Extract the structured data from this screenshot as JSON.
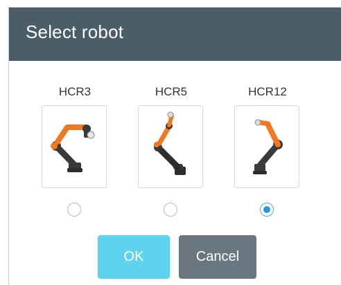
{
  "dialog": {
    "title": "Select robot"
  },
  "robots": [
    {
      "name": "HCR3",
      "selected": false,
      "image": "hcr3-robot-arm-image"
    },
    {
      "name": "HCR5",
      "selected": false,
      "image": "hcr5-robot-arm-image"
    },
    {
      "name": "HCR12",
      "selected": true,
      "image": "hcr12-robot-arm-image"
    }
  ],
  "buttons": {
    "ok_label": "OK",
    "cancel_label": "Cancel"
  },
  "colors": {
    "header_bg": "#4b5d69",
    "ok_bg": "#5dd3ee",
    "cancel_bg": "#6a7680",
    "radio_selected": "#2f95dc",
    "robot_orange": "#f07a22",
    "robot_dark": "#3a3a3a"
  }
}
